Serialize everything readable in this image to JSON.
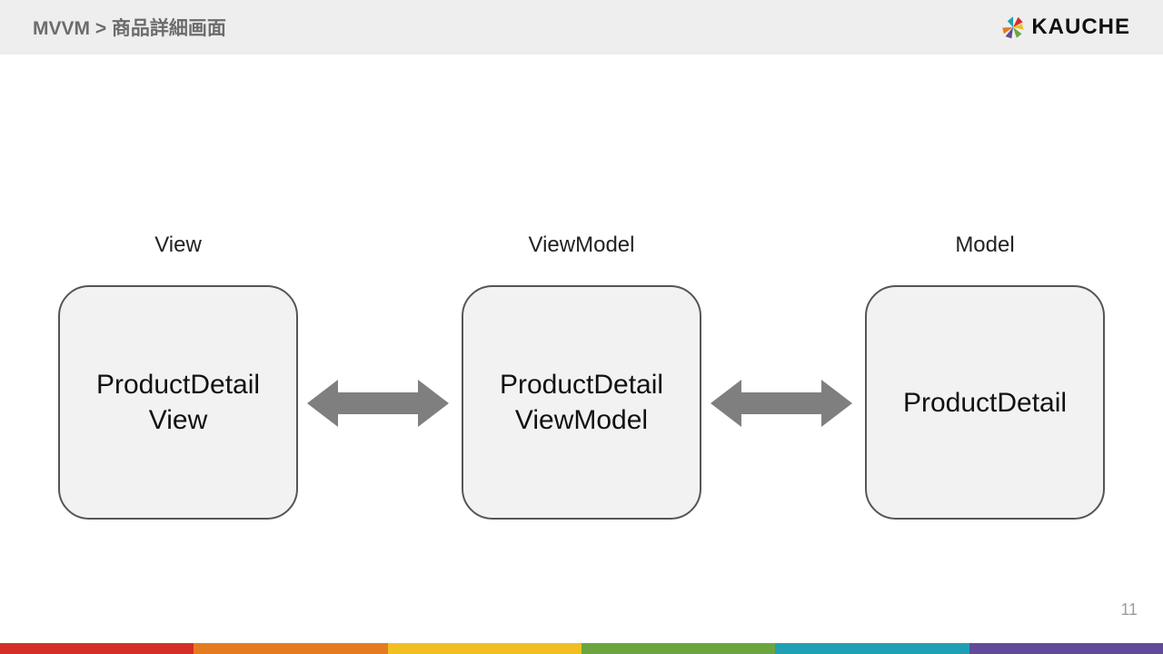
{
  "header": {
    "breadcrumb": "MVVM > 商品詳細画面",
    "logo_text": "KAUCHE"
  },
  "diagram": {
    "columns": [
      {
        "label": "View",
        "box_line1": "ProductDetail",
        "box_line2": "View"
      },
      {
        "label": "ViewModel",
        "box_line1": "ProductDetail",
        "box_line2": "ViewModel"
      },
      {
        "label": "Model",
        "box_line1": "ProductDetail",
        "box_line2": ""
      }
    ],
    "arrow_color": "#7f7f7f"
  },
  "page_number": "11",
  "bottom_strip_colors": [
    "#d42e29",
    "#e47b20",
    "#f2bf22",
    "#6aa63d",
    "#1e9fb3",
    "#614a9a"
  ]
}
